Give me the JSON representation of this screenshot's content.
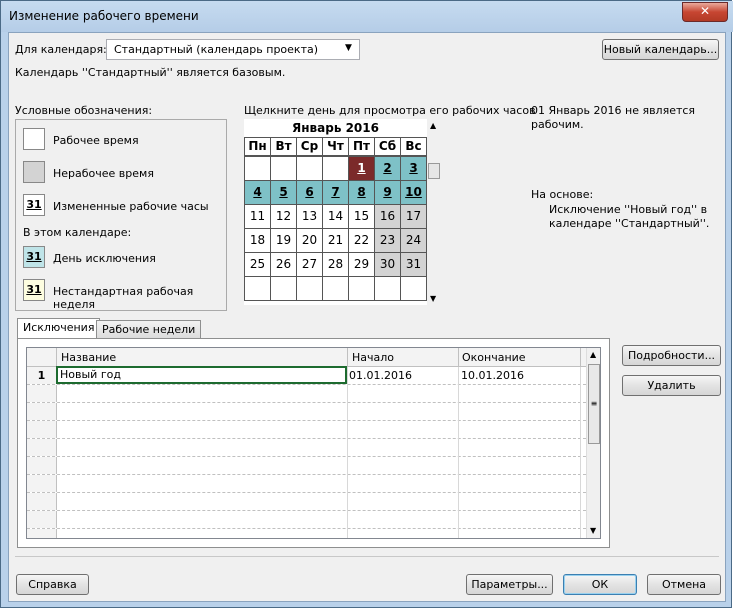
{
  "window": {
    "title": "Изменение рабочего времени",
    "close_glyph": "✕"
  },
  "calendar_selector": {
    "label": "Для календаря:",
    "value": "Стандартный (календарь проекта)",
    "new_calendar_button": "Новый календарь...",
    "base_note": "Календарь ''Стандартный'' является базовым."
  },
  "legend": {
    "title": "Условные обозначения:",
    "items": [
      {
        "label": "Рабочее время",
        "swatch_text": ""
      },
      {
        "label": "Нерабочее время",
        "swatch_text": ""
      },
      {
        "label": "Измененные рабочие часы",
        "swatch_text": "31"
      }
    ],
    "section_title": "В этом календаре:",
    "calendar_items": [
      {
        "label": "День исключения",
        "swatch_text": "31"
      },
      {
        "label": "Нестандартная рабочая неделя",
        "swatch_text": "31"
      }
    ]
  },
  "calendar": {
    "hint": "Щелкните день для просмотра его рабочих часов",
    "month": "Январь 2016",
    "weekdays": [
      "Пн",
      "Вт",
      "Ср",
      "Чт",
      "Пт",
      "Сб",
      "Вс"
    ],
    "weeks": [
      [
        "",
        "",
        "",
        "",
        "1",
        "2",
        "3"
      ],
      [
        "4",
        "5",
        "6",
        "7",
        "8",
        "9",
        "10"
      ],
      [
        "11",
        "12",
        "13",
        "14",
        "15",
        "16",
        "17"
      ],
      [
        "18",
        "19",
        "20",
        "21",
        "22",
        "23",
        "24"
      ],
      [
        "25",
        "26",
        "27",
        "28",
        "29",
        "30",
        "31"
      ],
      [
        "",
        "",
        "",
        "",
        "",
        "",
        ""
      ]
    ],
    "colors": {
      "selected": "#7b2a2a",
      "exception": "#7ec1c7",
      "nonworking": "#d3d3d3",
      "working": "#ffffff"
    }
  },
  "info": {
    "status": "01 Январь 2016 не является рабочим.",
    "based_on_label": "На основе:",
    "based_on_text": "Исключение ''Новый год'' в календаре ''Стандартный''."
  },
  "tabs": [
    {
      "label": "Исключения",
      "active": true
    },
    {
      "label": "Рабочие недели",
      "active": false
    }
  ],
  "table": {
    "columns": [
      "Название",
      "Начало",
      "Окончание"
    ],
    "rows": [
      {
        "num": "1",
        "name": "Новый год",
        "start": "01.01.2016",
        "end": "10.01.2016"
      }
    ]
  },
  "side_buttons": {
    "details": "Подробности...",
    "delete": "Удалить"
  },
  "footer": {
    "help": "Справка",
    "options": "Параметры...",
    "ok": "ОК",
    "cancel": "Отмена"
  }
}
